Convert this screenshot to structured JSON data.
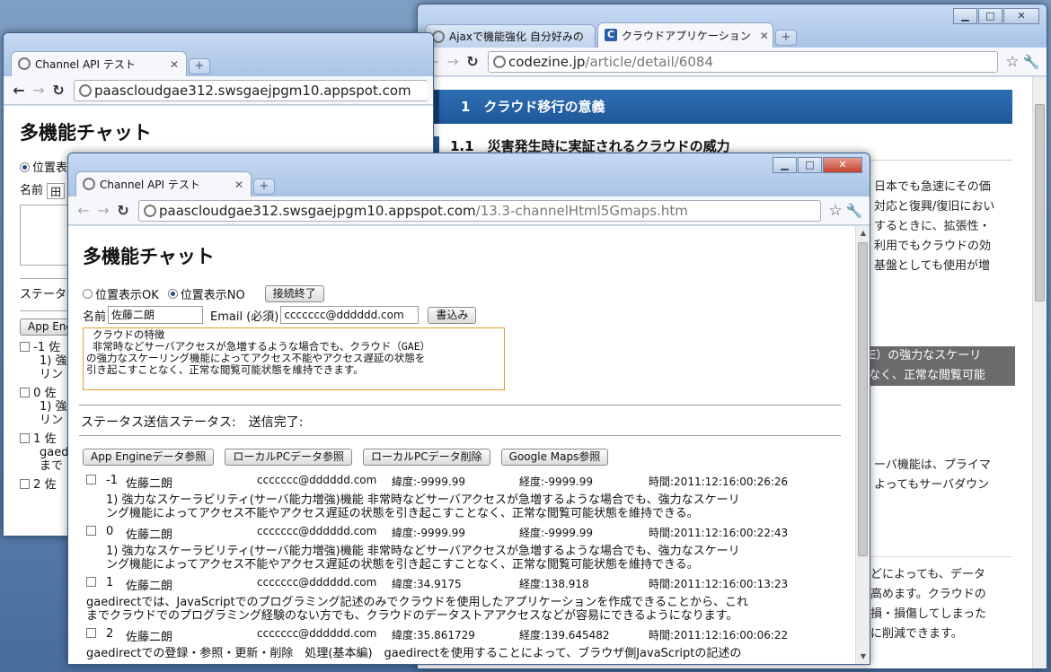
{
  "back_right": {
    "tabs": [
      {
        "label": "Ajaxで機能強化 自分好みの",
        "active": false
      },
      {
        "label": "クラウドアプリケーション",
        "active": true
      }
    ],
    "url_host": "codezine.jp",
    "url_path": "/article/detail/6084",
    "section_heading": "1　クラウド移行の意義",
    "sub_heading": "1.1　災害発生時に実証されるクラウドの威力",
    "para1": [
      "日本でも急速にその価",
      "対応と復興/復旧におい",
      "するときに、拡張性・",
      "利用でもクラウドの効",
      "基盤としても使用が増"
    ],
    "highlight": [
      "E）の強力なスケーリ",
      "なく、正常な閲覧可能"
    ],
    "para2": [
      "ーバ機能は、プライマ",
      "よってもサーバダウン"
    ],
    "para3": [
      "どによっても、データ",
      "高めます。クラウドの",
      "損・損傷してしまった",
      "に削減できます。"
    ]
  },
  "back_left": {
    "tab_label": "Channel API テスト",
    "url": "paascloudgae312.swsgaejpgm10.appspot.com",
    "title": "多機能チャット",
    "radio": "位置表",
    "name_label": "名前",
    "name_value": "田",
    "status_label": "ステータ",
    "button": "App Engin",
    "rows": [
      {
        "id": "-1",
        "lines": [
          "1) 強",
          "リン"
        ]
      },
      {
        "id": "0",
        "lines": [
          "1) 強",
          "リン"
        ]
      },
      {
        "id": "1",
        "lines": [
          "gaed",
          "まで"
        ]
      },
      {
        "id": "2",
        "lines": []
      }
    ],
    "row_trail": "佐"
  },
  "front": {
    "tab_label": "Channel API テスト",
    "url_host": "paascloudgae312.swsgaejpgm10.appspot.com",
    "url_path": "/13.3-channelHtml5Gmaps.htm",
    "title": "多機能チャット",
    "radio_ok": "位置表示OK",
    "radio_no": "位置表示NO",
    "disconnect": "接続終了",
    "name_label": "名前",
    "name_value": "佐藤二朗",
    "email_label": "Email (必須)",
    "email_value": "ccccccc@dddddd.com",
    "write_button": "書込み",
    "textarea_lines": [
      " クラウドの特徴",
      " 非常時などサーバアクセスが急増するような場合でも、クラウド（GAE）",
      "の強力なスケーリング機能によってアクセス不能やアクセス遅延の状態を",
      "引き起こすことなく、正常な閲覧可能状態を維持できます。"
    ],
    "status": "ステータス送信ステータス:　送信完了:",
    "buttons": [
      "App Engineデータ参照",
      "ローカルPCデータ参照",
      "ローカルPCデータ削除",
      "Google Maps参照"
    ],
    "entries": [
      {
        "id": "-1",
        "name": "佐藤二朗",
        "email": "ccccccc@dddddd.com",
        "lat": "緯度:-9999.99",
        "lon": "経度:-9999.99",
        "time": "時間:2011:12:16:00:26:26",
        "text": [
          "1) 強力なスケーラビリティ(サーバ能力増強)機能 非常時などサーバアクセスが急増するような場合でも、強力なスケーリ",
          "ング機能によってアクセス不能やアクセス遅延の状態を引き起こすことなく、正常な閲覧可能状態を維持できる。"
        ]
      },
      {
        "id": "0",
        "name": "佐藤二朗",
        "email": "ccccccc@dddddd.com",
        "lat": "緯度:-9999.99",
        "lon": "経度:-9999.99",
        "time": "時間:2011:12:16:00:22:43",
        "text": [
          "1) 強力なスケーラビリティ(サーバ能力増強)機能 非常時などサーバアクセスが急増するような場合でも、強力なスケーリ",
          "ング機能によってアクセス不能やアクセス遅延の状態を引き起こすことなく、正常な閲覧可能状態を維持できる。"
        ]
      },
      {
        "id": "1",
        "name": "佐藤二朗",
        "email": "ccccccc@dddddd.com",
        "lat": "緯度:34.9175",
        "lon": "経度:138.918",
        "time": "時間:2011:12:16:00:13:23",
        "text": [
          "gaedirectでは、JavaScriptでのプログラミング記述のみでクラウドを使用したアプリケーションを作成できることから、これ",
          "までクラウドでのプログラミング経験のない方でも、クラウドのデータストアアクセスなどが容易にできるようになります。"
        ]
      },
      {
        "id": "2",
        "name": "佐藤二朗",
        "email": "ccccccc@dddddd.com",
        "lat": "緯度:35.861729",
        "lon": "経度:139.645482",
        "time": "時間:2011:12:16:00:06:22",
        "text": [
          "gaedirectでの登録・参照・更新・削除　処理(基本編)　gaedirectを使用することによって、ブラウザ側JavaScriptの記述の"
        ]
      }
    ]
  }
}
